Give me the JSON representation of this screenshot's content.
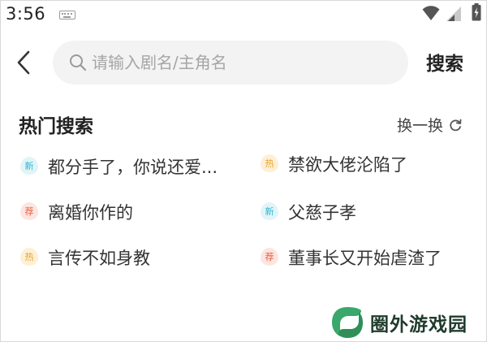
{
  "status_bar": {
    "time": "3:56",
    "icons": [
      "keyboard-icon",
      "wifi-icon",
      "signal-icon",
      "battery-icon"
    ]
  },
  "search": {
    "placeholder": "请输入剧名/主角名",
    "value": "",
    "submit_label": "搜索"
  },
  "hot_search": {
    "title": "热门搜索",
    "refresh_label": "换一换",
    "items": [
      {
        "badge": "新",
        "badge_type": "new",
        "label": "都分手了，你说还爱..."
      },
      {
        "badge": "热",
        "badge_type": "hot",
        "label": "禁欲大佬沦陷了"
      },
      {
        "badge": "荐",
        "badge_type": "rec",
        "label": "离婚你作的"
      },
      {
        "badge": "新",
        "badge_type": "new",
        "label": "父慈子孝"
      },
      {
        "badge": "热",
        "badge_type": "hot",
        "label": "言传不如身教"
      },
      {
        "badge": "荐",
        "badge_type": "rec",
        "label": "董事长又开始虐渣了"
      }
    ]
  },
  "watermark": {
    "text": "圈外游戏园"
  },
  "colors": {
    "badge_new": "#2fb6cf",
    "badge_hot": "#e9a32a",
    "badge_rec": "#ea5c42",
    "search_bg": "#f3f3f3",
    "watermark_green": "#3aa86a"
  }
}
